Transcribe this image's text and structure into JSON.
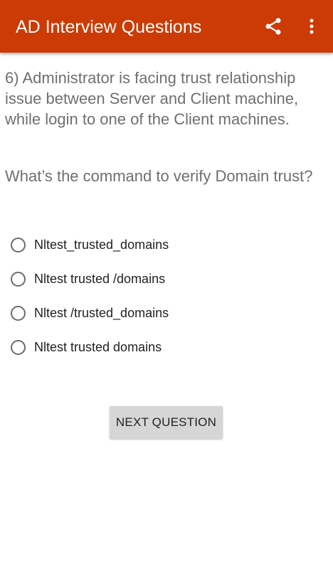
{
  "appbar": {
    "title": "AD Interview Questions",
    "share_icon": "share-icon",
    "menu_icon": "more-vert-icon",
    "color": "#cc3b05"
  },
  "question": {
    "text": "6) Administrator is facing trust relationship issue between Server and Client machine, while login to one of the Client machines.",
    "prompt": "What’s the command to verify Domain trust?"
  },
  "options": [
    {
      "label": "Nltest_trusted_domains",
      "selected": false
    },
    {
      "label": "Nltest trusted /domains",
      "selected": false
    },
    {
      "label": "Nltest /trusted_domains",
      "selected": false
    },
    {
      "label": "Nltest trusted domains",
      "selected": false
    }
  ],
  "next_button": {
    "label": "NEXT QUESTION"
  }
}
